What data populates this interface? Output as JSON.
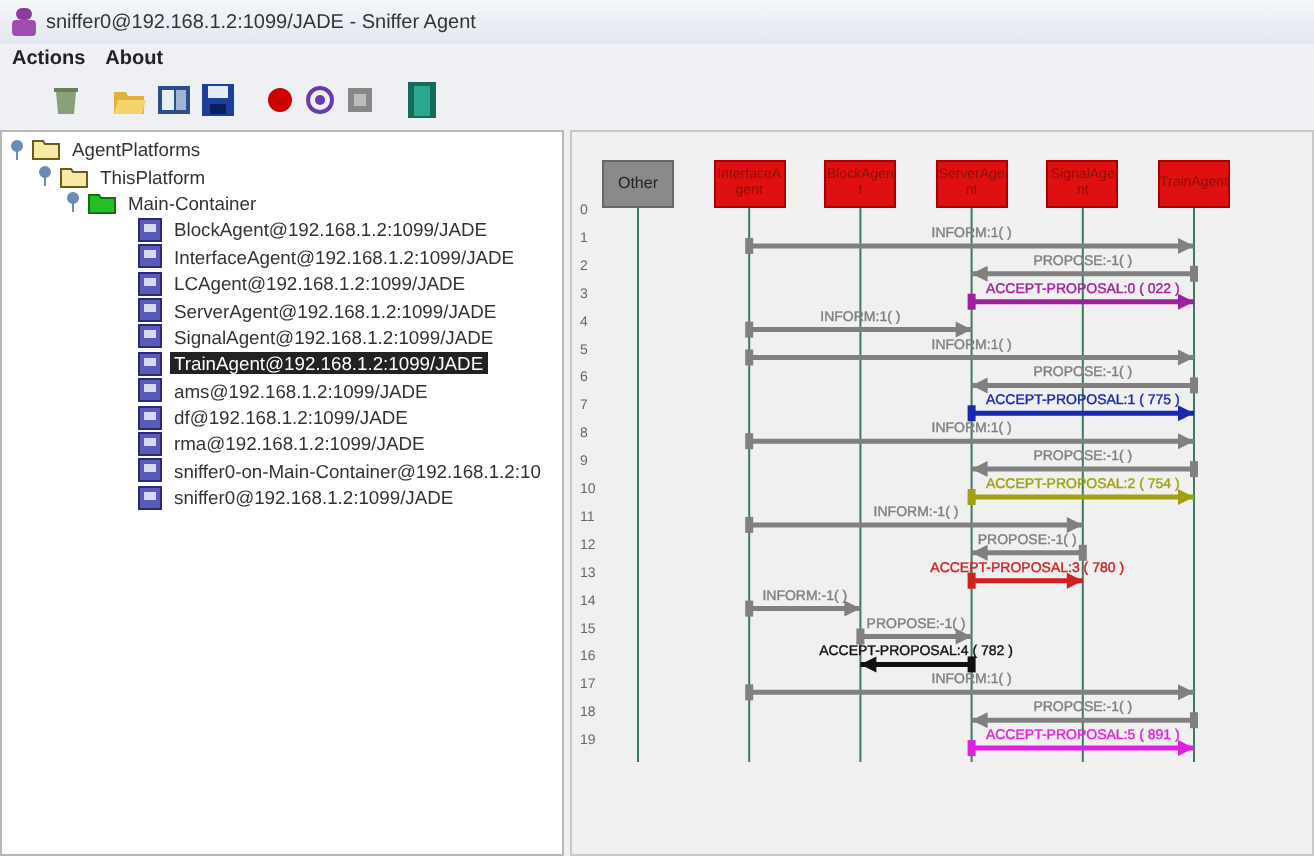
{
  "window": {
    "title": "sniffer0@192.168.1.2:1099/JADE - Sniffer Agent"
  },
  "menu": [
    "Actions",
    "About"
  ],
  "tree": [
    {
      "label": "AgentPlatforms",
      "kind": "folder",
      "expanded": true,
      "selected": false,
      "children": [
        {
          "label": "ThisPlatform",
          "kind": "folder",
          "expanded": true,
          "selected": false,
          "children": [
            {
              "label": "Main-Container",
              "kind": "container",
              "expanded": true,
              "selected": false,
              "children": [
                {
                  "label": "BlockAgent@192.168.1.2:1099/JADE",
                  "kind": "agent",
                  "selected": false
                },
                {
                  "label": "InterfaceAgent@192.168.1.2:1099/JADE",
                  "kind": "agent",
                  "selected": false
                },
                {
                  "label": "LCAgent@192.168.1.2:1099/JADE",
                  "kind": "agent",
                  "selected": false
                },
                {
                  "label": "ServerAgent@192.168.1.2:1099/JADE",
                  "kind": "agent",
                  "selected": false
                },
                {
                  "label": "SignalAgent@192.168.1.2:1099/JADE",
                  "kind": "agent",
                  "selected": false
                },
                {
                  "label": "TrainAgent@192.168.1.2:1099/JADE",
                  "kind": "agent",
                  "selected": true
                },
                {
                  "label": "ams@192.168.1.2:1099/JADE",
                  "kind": "agent",
                  "selected": false
                },
                {
                  "label": "df@192.168.1.2:1099/JADE",
                  "kind": "agent",
                  "selected": false
                },
                {
                  "label": "rma@192.168.1.2:1099/JADE",
                  "kind": "agent",
                  "selected": false
                },
                {
                  "label": "sniffer0-on-Main-Container@192.168.1.2:10",
                  "kind": "agent",
                  "selected": false
                },
                {
                  "label": "sniffer0@192.168.1.2:1099/JADE",
                  "kind": "agent",
                  "selected": false
                }
              ]
            }
          ]
        }
      ]
    }
  ],
  "sniffer": {
    "agents": [
      {
        "name": "Other",
        "kind": "other"
      },
      {
        "name": "InterfaceAgent",
        "kind": "agent"
      },
      {
        "name": "BlockAgent",
        "kind": "agent"
      },
      {
        "name": "ServerAgent",
        "kind": "agent"
      },
      {
        "name": "SignalAgent",
        "kind": "agent"
      },
      {
        "name": "TrainAgent",
        "kind": "agent"
      }
    ],
    "row_numbers": [
      "0",
      "1",
      "2",
      "3",
      "4",
      "5",
      "6",
      "7",
      "8",
      "9",
      "10",
      "11",
      "12",
      "13",
      "14",
      "15",
      "16",
      "17",
      "18",
      "19"
    ],
    "messages": [
      {
        "label": "INFORM:1(   )",
        "color": "#808080"
      },
      {
        "label": "PROPOSE:-1(   )",
        "color": "#808080"
      },
      {
        "label": "ACCEPT-PROPOSAL:0 (  022  )",
        "color": "#a0209c"
      },
      {
        "label": "INFORM:1(   )",
        "color": "#808080"
      },
      {
        "label": "INFORM:1(   )",
        "color": "#808080"
      },
      {
        "label": "PROPOSE:-1(   )",
        "color": "#808080"
      },
      {
        "label": "ACCEPT-PROPOSAL:1 (  775  )",
        "color": "#1a28b0"
      },
      {
        "label": "INFORM:1(   )",
        "color": "#808080"
      },
      {
        "label": "PROPOSE:-1(   )",
        "color": "#808080"
      },
      {
        "label": "ACCEPT-PROPOSAL:2 (  754  )",
        "color": "#a0a010"
      },
      {
        "label": "INFORM:-1(   )",
        "color": "#808080"
      },
      {
        "label": "PROPOSE:-1(   )",
        "color": "#808080"
      },
      {
        "label": "ACCEPT-PROPOSAL:3 (  780  )",
        "color": "#d02020"
      },
      {
        "label": "INFORM:-1(   )",
        "color": "#808080"
      },
      {
        "label": "PROPOSE:-1(   )",
        "color": "#808080"
      },
      {
        "label": "ACCEPT-PROPOSAL:4 (  782  )",
        "color": "#101010"
      },
      {
        "label": "INFORM:1(   )",
        "color": "#808080"
      },
      {
        "label": "PROPOSE:-1(   )",
        "color": "#808080"
      },
      {
        "label": "ACCEPT-PROPOSAL:5 (  891  )",
        "color": "#e020e0"
      }
    ]
  }
}
